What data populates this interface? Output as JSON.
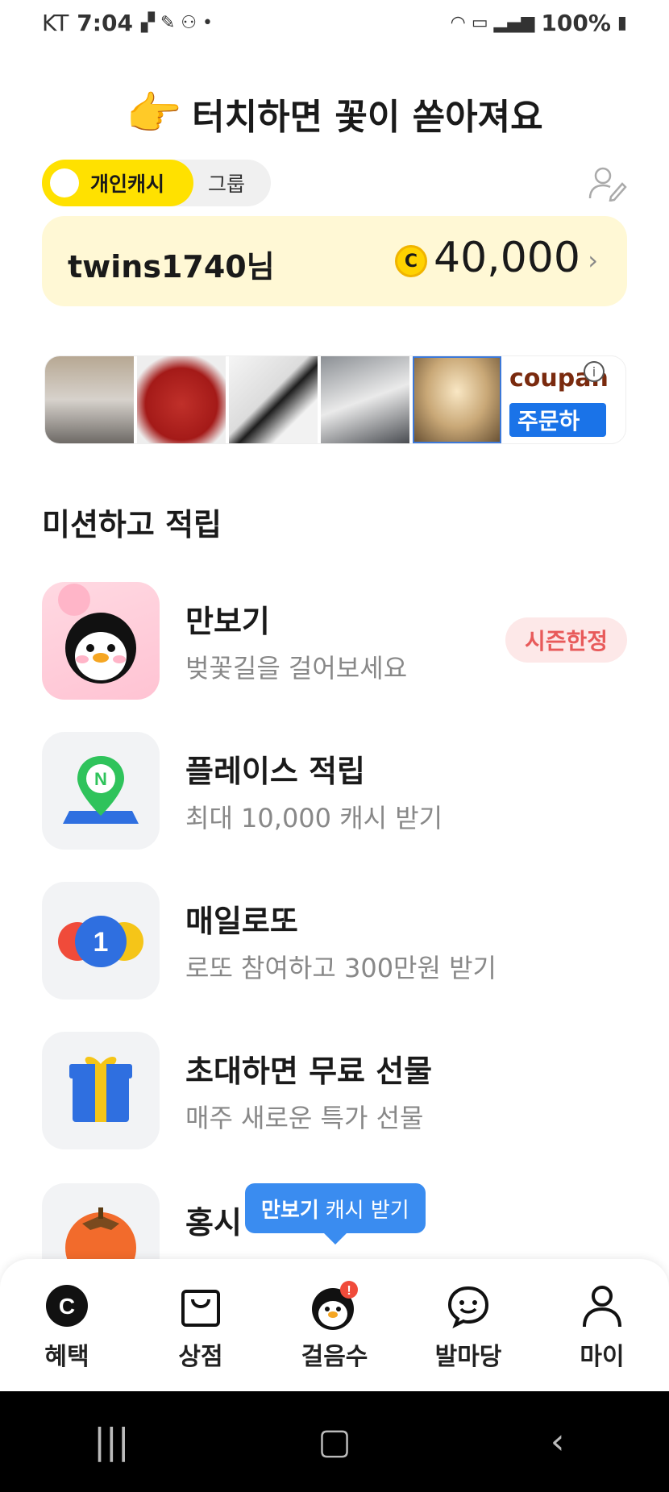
{
  "status_bar": {
    "carrier": "KT",
    "time": "7:04",
    "battery": "100%"
  },
  "banner": {
    "text": "터치하면 꽃이 쏟아져요"
  },
  "toggle": {
    "personal": "개인캐시",
    "group": "그룹"
  },
  "cash": {
    "username": "twins1740님",
    "coin_symbol": "C",
    "amount": "40,000"
  },
  "ad": {
    "brand": "coupan",
    "cta": "주문하"
  },
  "section": {
    "title": "미션하고 적립"
  },
  "missions": [
    {
      "title": "만보기",
      "desc": "벚꽃길을 걸어보세요",
      "badge": "시즌한정"
    },
    {
      "title": "플레이스 적립",
      "desc": "최대 10,000 캐시 받기"
    },
    {
      "title": "매일로또",
      "desc": "로또 참여하고 300만원 받기",
      "icon_number": "1"
    },
    {
      "title": "초대하면 무료 선물",
      "desc": "매주 새로운 특가 선물"
    },
    {
      "title": "홍시"
    }
  ],
  "tooltip": {
    "bold": "만보기",
    "text": "캐시 받기"
  },
  "bottom_nav": [
    {
      "label": "혜택",
      "icon": "cash-coin-icon"
    },
    {
      "label": "상점",
      "icon": "shopping-bag-icon"
    },
    {
      "label": "걸음수",
      "icon": "penguin-icon"
    },
    {
      "label": "발마당",
      "icon": "chat-smile-icon"
    },
    {
      "label": "마이",
      "icon": "person-icon"
    }
  ],
  "colors": {
    "accent_yellow": "#ffe100",
    "card_bg": "#fff8d5",
    "badge_red": "#e85a5a",
    "tooltip_blue": "#3a8cf0"
  }
}
